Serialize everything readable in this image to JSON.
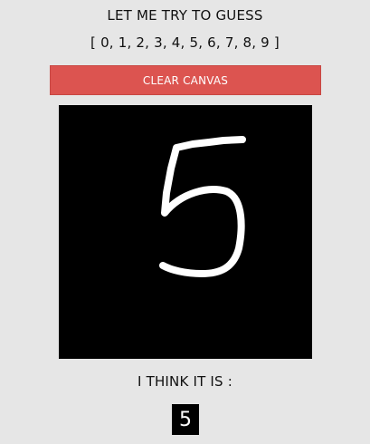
{
  "header": {
    "title": "LET ME TRY TO GUESS",
    "digits": "[ 0, 1, 2, 3, 4, 5, 6, 7, 8, 9 ]"
  },
  "toolbar": {
    "clear_label": "CLEAR CANVAS"
  },
  "canvas": {
    "background": "#000000",
    "stroke_color": "#ffffff",
    "drawn_digit": "5"
  },
  "result": {
    "label": "I THINK IT IS :",
    "prediction": "5"
  },
  "colors": {
    "page_background": "#e6e6e6",
    "button": "#dc5450"
  }
}
